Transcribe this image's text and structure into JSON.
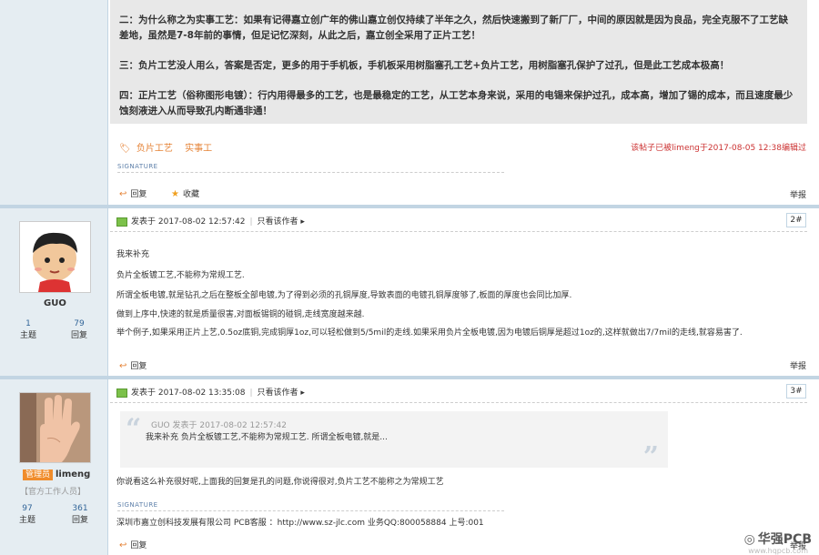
{
  "prev_post": {
    "paragraphs": [
      "二：为什么称之为实事工艺：如果有记得嘉立创广年的佛山嘉立创仅持续了半年之久，然后快速搬到了新厂厂，中间的原因就是因为良品，完全克服不了工艺缺",
      "差地，虽然是7-8年前的事情，但足记忆深刻，从此之后，嘉立创全采用了正片工艺！",
      "三：负片工艺没人用么，答案是否定，更多的用于手机板，手机板采用树脂塞孔工艺+负片工艺，用树脂塞孔保护了过孔，但是此工艺成本极高！",
      "四：正片工艺（俗称图形电镀）：行内用得最多的工艺，也是最稳定的工艺，从工艺本身来说，采用的电锡来保护过孔，成本高，增加了锡的成本，而且速度最少",
      "蚀刻液进入从而导致孔内断通非通！"
    ],
    "tags": [
      "负片工艺",
      "实事工"
    ],
    "edited_text": "该帖子已被limeng于2017-08-05 12:38编辑过",
    "signature_label": "SIGNATURE",
    "actions": {
      "reply": "回复",
      "favorite": "收藏",
      "report": "举报"
    }
  },
  "post1": {
    "username": "GUO",
    "stats": [
      {
        "value": "1",
        "label": "主题"
      },
      {
        "value": "79",
        "label": "回复"
      }
    ],
    "posted_at": "发表于 2017-08-02 12:57:42",
    "only_author": "只看该作者",
    "floor": "2#",
    "lines": [
      "我来补充",
      "负片全板镀工艺,不能称为常规工艺.",
      "所谓全板电镀,就是钻孔之后在整板全部电镀,为了得到必须的孔铜厚度,导致表面的电镀孔铜厚度够了,板面的厚度也会同比加厚.",
      "做到上序中,快速的就是质量很害,对面板锡铜的碰铜,走线宽度越来越.",
      "举个例子,如果采用正片上艺,0.5oz底铜,完成铜厚1oz,可以轻松做到5/5mil的走线.如果采用负片全板电镀,因为电镀后铜厚是超过1oz的,这样就做出7/7mil的走线,就容易害了."
    ],
    "actions": {
      "reply": "回复",
      "report": "举报"
    }
  },
  "post2": {
    "username": "limeng",
    "role_badge": "管理员",
    "role_text": "【官方工作人员】",
    "stats": [
      {
        "value": "97",
        "label": "主题"
      },
      {
        "value": "361",
        "label": "回复"
      }
    ],
    "posted_at": "发表于 2017-08-02 13:35:08",
    "only_author": "只看该作者",
    "floor": "3#",
    "quote_author": "GUO 发表于 2017-08-02 12:57:42",
    "quote_text": "我来补充 负片全板镀工艺,不能称为常规工艺. 所谓全板电镀,就是...",
    "reply_text": "你说看这么补充很好呢,上面我的回复是孔的问题,你说得很对,负片工艺不能称之为常规工艺",
    "signature_label": "SIGNATURE",
    "signature_text": "深圳市嘉立创科技发展有限公司 PCB客服 ：http://www.sz-jlc.com 业务QQ:800058884 上号:001",
    "actions": {
      "reply": "回复",
      "report": "举报"
    }
  },
  "watermark": {
    "main": "华强PCB",
    "sub": "www.hqpcb.com"
  }
}
